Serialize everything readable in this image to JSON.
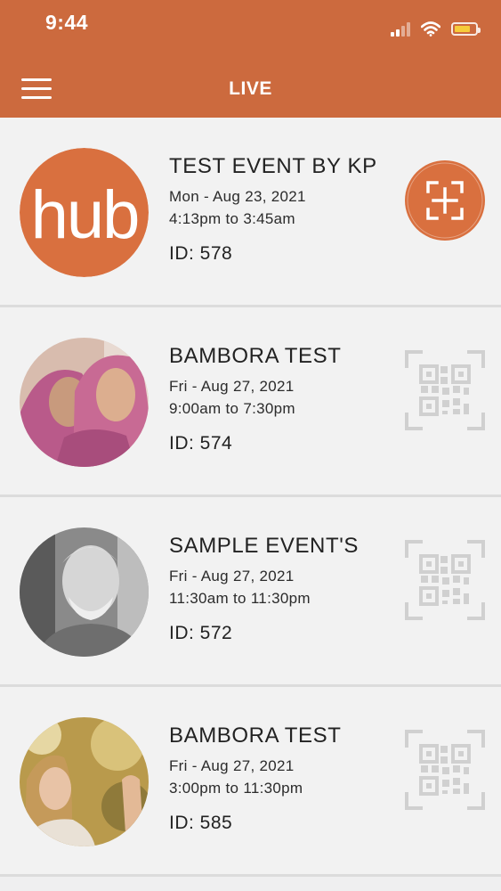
{
  "status_bar": {
    "time": "9:44"
  },
  "header": {
    "title": "LIVE"
  },
  "colors": {
    "accent": "#cc6a3e",
    "background": "#efeff0",
    "qr_inactive": "#d0d0d0"
  },
  "events": [
    {
      "title": "TEST EVENT BY KP",
      "date": "Mon - Aug 23, 2021",
      "time": "4:13pm to 3:45am",
      "id_text": "ID: 578",
      "avatar": "hub-logo",
      "logo_text": "hub",
      "action_icon": "scan-plus-icon",
      "action_active": true
    },
    {
      "title": "BAMBORA TEST",
      "date": "Fri - Aug 27, 2021",
      "time": "9:00am to 7:30pm",
      "id_text": "ID: 574",
      "avatar": "two-women-photo",
      "action_icon": "qr-code-icon",
      "action_active": false
    },
    {
      "title": "SAMPLE EVENT'S",
      "date": "Fri - Aug 27, 2021",
      "time": "11:30am to 11:30pm",
      "id_text": "ID: 572",
      "avatar": "elderly-man-photo",
      "action_icon": "qr-code-icon",
      "action_active": false
    },
    {
      "title": "BAMBORA TEST",
      "date": "Fri - Aug 27, 2021",
      "time": "3:00pm to 11:30pm",
      "id_text": "ID: 585",
      "avatar": "woman-selfie-photo",
      "action_icon": "qr-code-icon",
      "action_active": false
    }
  ]
}
